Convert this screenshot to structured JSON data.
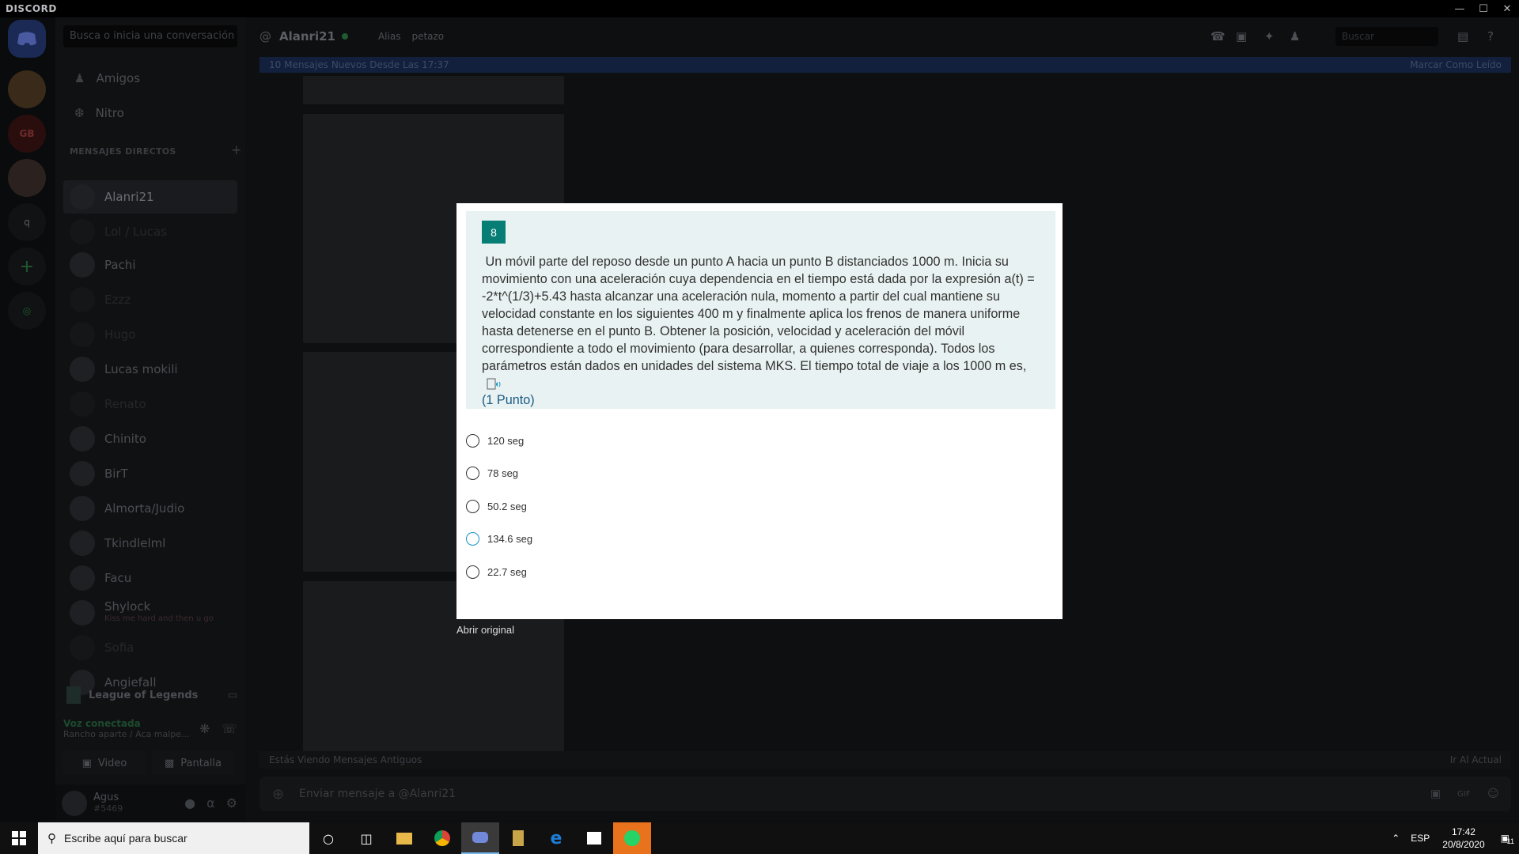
{
  "titlebar": {
    "app_name": "DISCORD"
  },
  "dms": {
    "search_placeholder": "Busca o inicia una conversación",
    "friends_label": "Amigos",
    "nitro_label": "Nitro",
    "section_header": "MENSAJES DIRECTOS",
    "items": [
      "Alanri21",
      "Lol / Lucas",
      "Pachi",
      "Ezzz",
      "Hugo",
      "Lucas mokili",
      "Renato",
      "Chinito",
      "BirT",
      "Almorta/Judio",
      "Tkindlelml",
      "Facu",
      "Shylock",
      "Sofia",
      "Angiefall"
    ],
    "shylock_status": "Kiss me hard and then u go",
    "game_activity": "League of Legends",
    "voice_status": "Voz conectada",
    "voice_channel": "Rancho aparte / Aca malpe...",
    "video_label": "Video",
    "screen_label": "Pantalla",
    "username": "Agus",
    "tag": "#5469"
  },
  "chat": {
    "header_name": "Alanri21",
    "alias_label": "Alias",
    "alias_value": "petazo",
    "search_placeholder": "Buscar",
    "new_messages": "10 Mensajes Nuevos Desde Las 17:37",
    "mark_read": "Marcar Como Leído",
    "older_messages": "Estás Viendo Mensajes Antiguos",
    "jump_present": "Ir Al Actual",
    "input_placeholder": "Enviar mensaje a @Alanri21"
  },
  "question": {
    "number": "8",
    "text": "Un móvil parte del reposo desde un punto A hacia un punto B distanciados 1000 m. Inicia su movimiento con una aceleración cuya dependencia en el tiempo está dada por la expresión a(t) = -2*t^(1/3)+5.43 hasta alcanzar una aceleración nula, momento a partir del cual mantiene su velocidad constante en los siguientes 400 m y finalmente aplica los frenos de manera uniforme hasta detenerse en el punto B. Obtener la posición, velocidad y aceleración del móvil correspondiente a todo el movimiento (para desarrollar, a quienes corresponda). Todos los parámetros están dados en unidades del sistema MKS. El tiempo total de viaje a los 1000 m es,",
    "points": "(1 Punto)",
    "options": [
      "120 seg",
      "78 seg",
      "50.2 seg",
      "134.6 seg",
      "22.7 seg"
    ]
  },
  "modal": {
    "open_original": "Abrir original"
  },
  "taskbar": {
    "search_placeholder": "Escribe aquí para buscar",
    "lang": "ESP",
    "time": "17:42",
    "date": "20/8/2020",
    "notif_count": "11"
  }
}
